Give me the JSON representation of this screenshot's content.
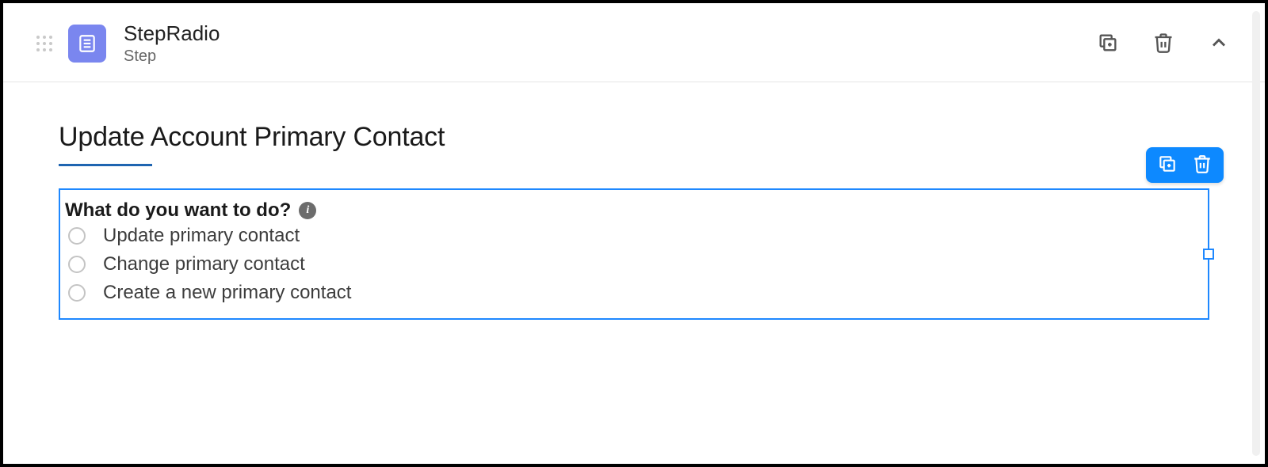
{
  "header": {
    "title": "StepRadio",
    "subtitle": "Step"
  },
  "section": {
    "heading": "Update Account Primary Contact"
  },
  "question": {
    "label": "What do you want to do?",
    "info_glyph": "i",
    "options": [
      "Update primary contact",
      "Change primary contact",
      "Create a new primary contact"
    ]
  },
  "colors": {
    "accent": "#1e88ff",
    "icon_bg": "#7a86ef"
  }
}
